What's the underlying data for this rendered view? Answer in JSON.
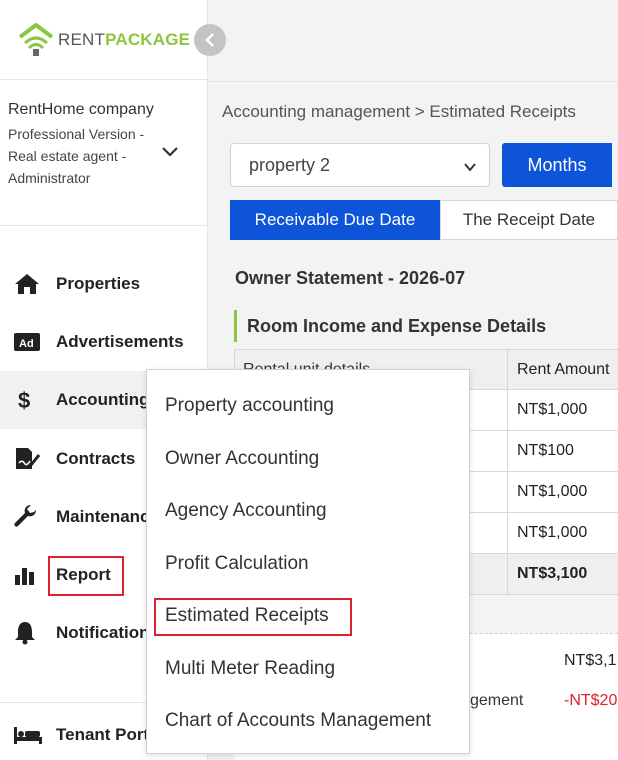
{
  "app": {
    "logo_text_a": "RENT",
    "logo_text_b": "PACKAGE",
    "brand_green": "#8cc63f",
    "accent_blue": "#0d54d8",
    "highlight_red": "#d9232d"
  },
  "company": {
    "name": "RentHome company",
    "role": "Professional Version - Real estate agent - Administrator"
  },
  "sidebar": {
    "items": [
      {
        "label": "Properties",
        "icon": "home-icon"
      },
      {
        "label": "Advertisements",
        "icon": "ad-icon"
      },
      {
        "label": "Accounting",
        "icon": "dollar-icon"
      },
      {
        "label": "Contracts",
        "icon": "contract-icon"
      },
      {
        "label": "Maintenance",
        "icon": "wrench-icon"
      },
      {
        "label": "Report",
        "icon": "bar-chart-icon"
      },
      {
        "label": "Notifications",
        "icon": "bell-icon"
      },
      {
        "label": "Tenant Portal",
        "icon": "bed-icon"
      }
    ]
  },
  "main": {
    "breadcrumb": "Accounting management > Estimated Receipts",
    "property_select": "property 2",
    "months_button": "Months",
    "tabs": [
      "Receivable Due Date",
      "The Receipt Date"
    ],
    "statement_title": "Owner Statement - 2026-07",
    "section_title": "Room Income and Expense Details",
    "table": {
      "headers": [
        "Rental unit details",
        "Rent Amount"
      ],
      "rows": [
        [
          "",
          "NT$1,000"
        ],
        [
          "",
          "NT$100"
        ],
        [
          "",
          "NT$1,000"
        ],
        [
          "",
          "NT$1,000"
        ]
      ],
      "total": [
        "",
        "NT$3,100"
      ]
    },
    "summary": {
      "line1_value": "NT$3,1",
      "line2_label": "gement",
      "line2_value": "-NT$20"
    }
  },
  "dropdown": {
    "items": [
      "Property accounting",
      "Owner Accounting",
      "Agency Accounting",
      "Profit Calculation",
      "Estimated Receipts",
      "Multi Meter Reading",
      "Chart of Accounts Management"
    ]
  }
}
